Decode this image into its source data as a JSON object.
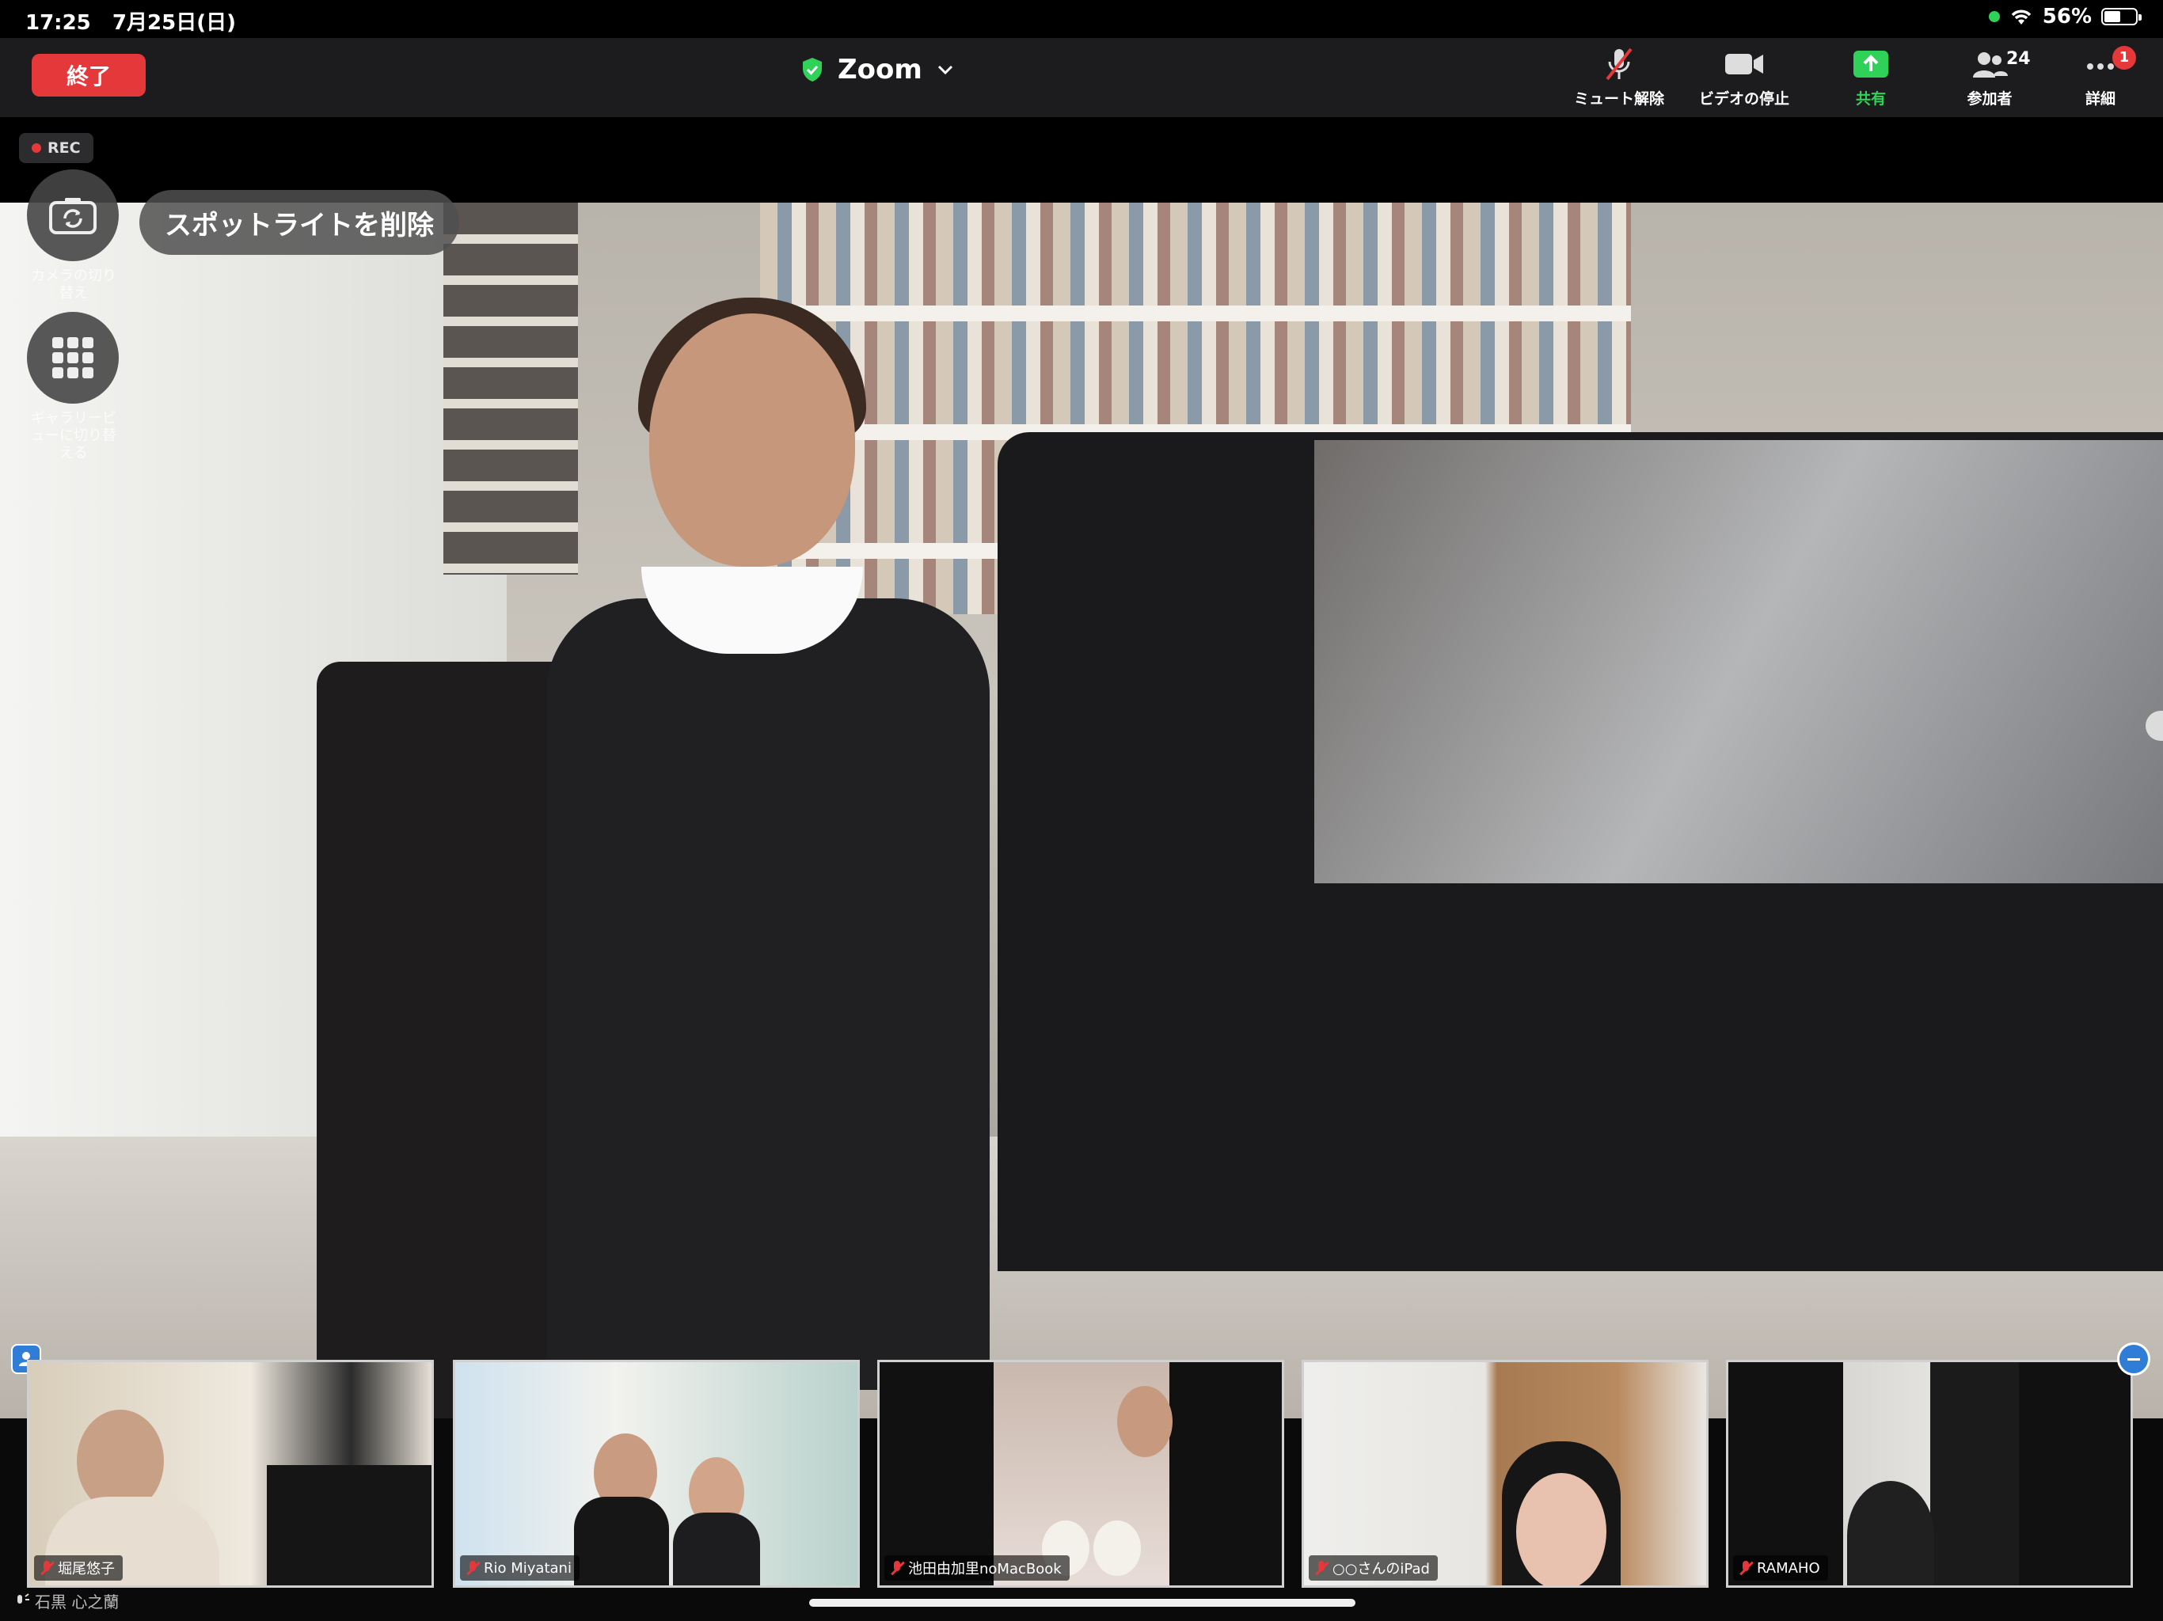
{
  "status_bar": {
    "time": "17:25",
    "date": "7月25日(日)",
    "battery": "56%",
    "battery_level": 0.56
  },
  "toolbar": {
    "end_label": "終了",
    "title": "Zoom",
    "unmute_label": "ミュート解除",
    "stop_video_label": "ビデオの停止",
    "share_label": "共有",
    "participants_label": "参加者",
    "participants_count": "24",
    "more_label": "詳細",
    "more_badge": "1"
  },
  "rec_label": "REC",
  "main": {
    "spotlight_button": "スポットライトを削除",
    "camera_switch_label": "カメラの切り替え",
    "gallery_label": "ギャラリービューに切り替える"
  },
  "thumbnails": [
    {
      "name": "堀尾悠子"
    },
    {
      "name": "Rio Miyatani"
    },
    {
      "name": "池田由加里noMacBook"
    },
    {
      "name": "○○さんのiPad"
    },
    {
      "name": "RAMAHO"
    }
  ],
  "speaker_name": "石黒 心之蘭",
  "colors": {
    "end": "#e5383b",
    "share": "#30d158",
    "toolbar": "#1c1c1e",
    "accent": "#2f7dd6"
  }
}
